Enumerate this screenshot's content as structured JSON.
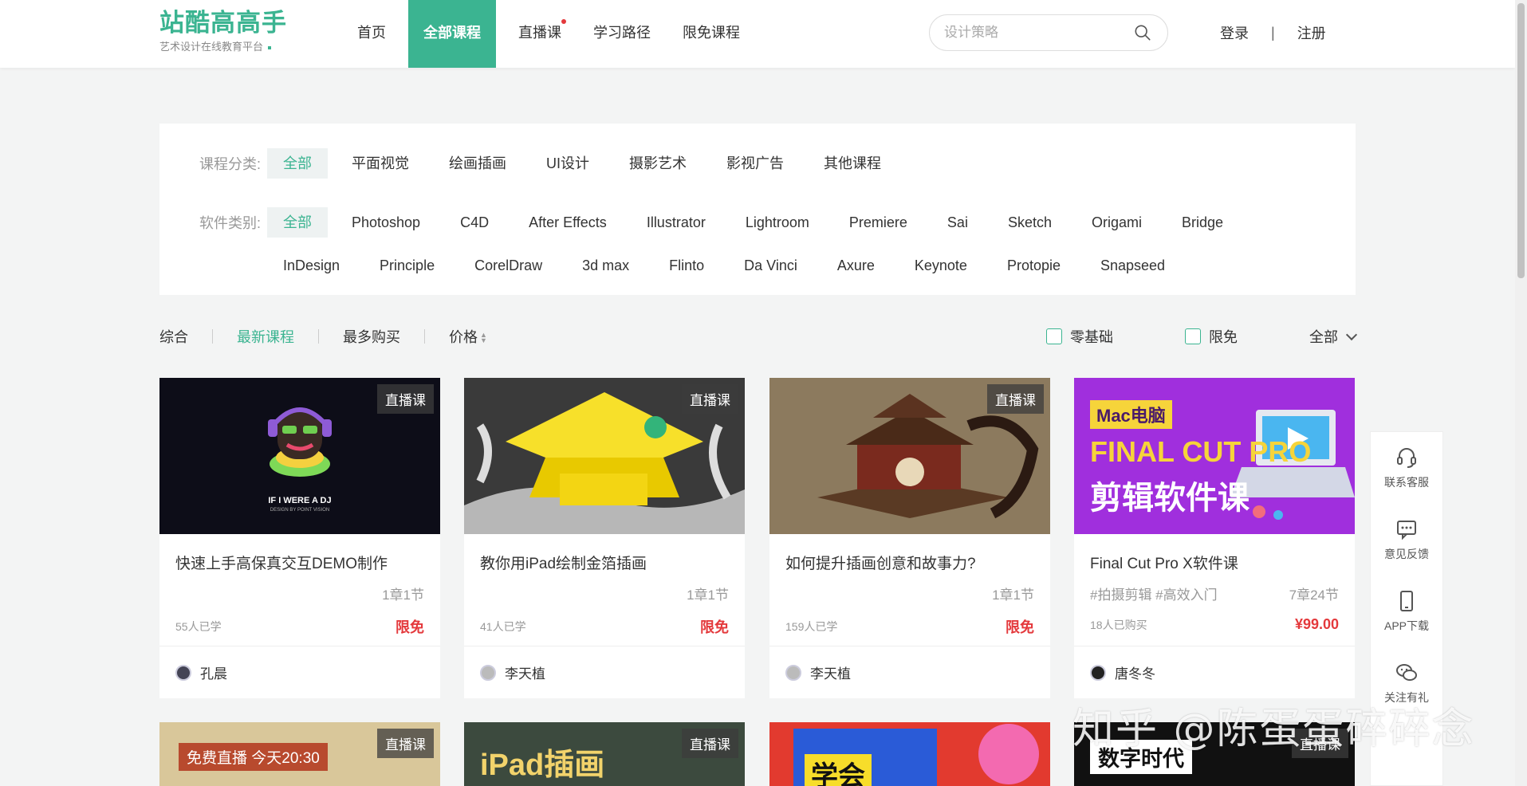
{
  "logo": {
    "title": "站酷高高手",
    "subtitle": "艺术设计在线教育平台"
  },
  "nav": [
    {
      "label": "首页"
    },
    {
      "label": "全部课程",
      "active": true
    },
    {
      "label": "直播课",
      "dot": true
    },
    {
      "label": "学习路径"
    },
    {
      "label": "限免课程"
    }
  ],
  "search": {
    "placeholder": "设计策略"
  },
  "auth": {
    "login": "登录",
    "separator": "|",
    "register": "注册"
  },
  "filters": {
    "category_label": "课程分类:",
    "categories": [
      "全部",
      "平面视觉",
      "绘画插画",
      "UI设计",
      "摄影艺术",
      "影视广告",
      "其他课程"
    ],
    "software_label": "软件类别:",
    "software_row1": [
      "全部",
      "Photoshop",
      "C4D",
      "After Effects",
      "Illustrator",
      "Lightroom",
      "Premiere",
      "Sai",
      "Sketch",
      "Origami",
      "Bridge"
    ],
    "software_row2": [
      "InDesign",
      "Principle",
      "CorelDraw",
      "3d max",
      "Flinto",
      "Da Vinci",
      "Axure",
      "Keynote",
      "Protopie",
      "Snapseed"
    ]
  },
  "sort": {
    "options": [
      "综合",
      "最新课程",
      "最多购买",
      "价格"
    ],
    "selected": "最新课程",
    "check_zero": "零基础",
    "check_free": "限免",
    "dropdown": "全部"
  },
  "courses": [
    {
      "tag": "直播课",
      "title": "快速上手高保真交互DEMO制作",
      "tags": "",
      "chapters": "1章1节",
      "learners": "55人已学",
      "price": "限免",
      "author": "孔晨",
      "thumb_text": "IF I WERE A DJ",
      "thumb_sub": "DESIGN BY POINT VISION"
    },
    {
      "tag": "直播课",
      "title": "教你用iPad绘制金箔插画",
      "tags": "",
      "chapters": "1章1节",
      "learners": "41人已学",
      "price": "限免",
      "author": "李天植"
    },
    {
      "tag": "直播课",
      "title": "如何提升插画创意和故事力?",
      "tags": "",
      "chapters": "1章1节",
      "learners": "159人已学",
      "price": "限免",
      "author": "李天植"
    },
    {
      "tag": "",
      "title": "Final Cut Pro X软件课",
      "tags": "#拍摄剪辑 #高效入门",
      "chapters": "7章24节",
      "learners": "18人已购买",
      "price": "¥99.00",
      "author": "唐冬冬",
      "thumb_badge": "Mac电脑",
      "thumb_line1": "FINAL CUT PRO",
      "thumb_line2": "剪辑软件课"
    }
  ],
  "courses_row2": [
    {
      "tag": "直播课",
      "badge": "免费直播 今天20:30"
    },
    {
      "tag": "直播课",
      "text": "iPad插画"
    },
    {
      "tag": "",
      "text": "学会"
    },
    {
      "tag": "直播课",
      "text": "数字时代"
    }
  ],
  "side": [
    "联系客服",
    "意见反馈",
    "APP下载",
    "关注有礼"
  ],
  "watermark": "知乎 @陈蛋蛋碎碎念",
  "colors": {
    "brand": "#3bb491",
    "price": "#e4393c"
  }
}
